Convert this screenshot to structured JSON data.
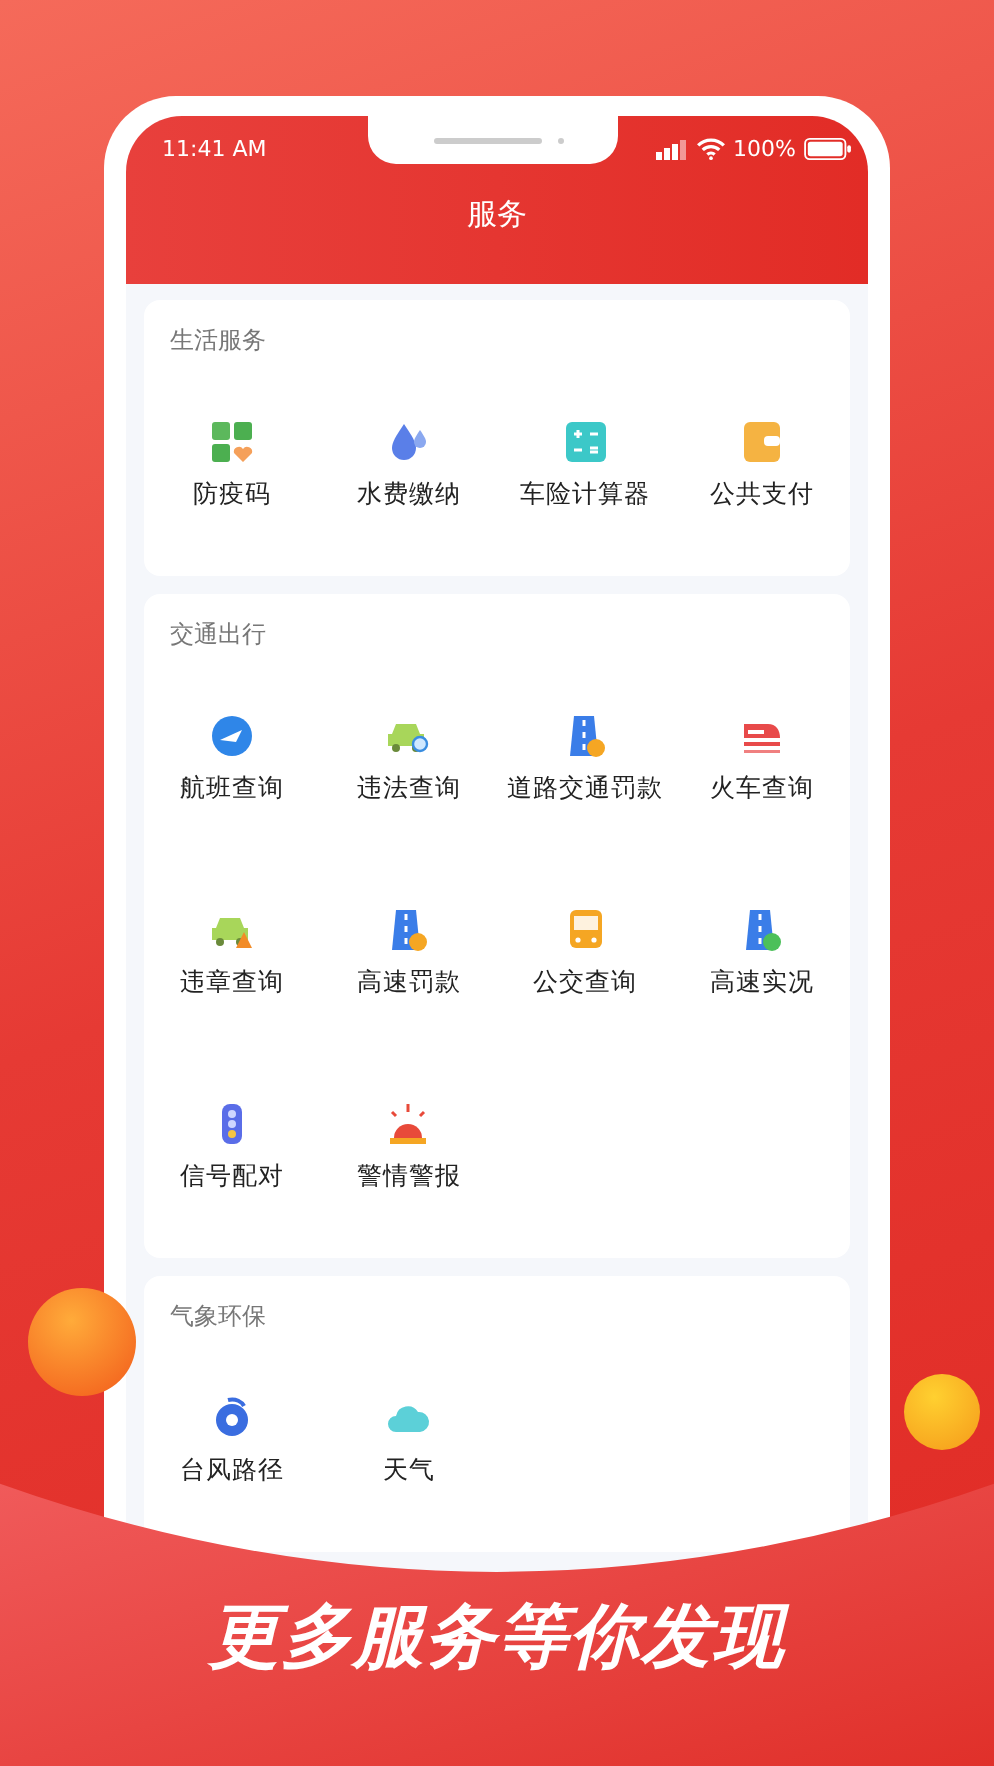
{
  "status_bar": {
    "time": "11:41 AM",
    "battery": "100%"
  },
  "header": {
    "title": "服务"
  },
  "sections": [
    {
      "title": "生活服务",
      "items": [
        {
          "label": "防疫码",
          "kind": "health-code"
        },
        {
          "label": "水费缴纳",
          "kind": "water"
        },
        {
          "label": "车险计算器",
          "kind": "calculator"
        },
        {
          "label": "公共支付",
          "kind": "wallet"
        }
      ]
    },
    {
      "title": "交通出行",
      "items": [
        {
          "label": "航班查询",
          "kind": "flight"
        },
        {
          "label": "违法查询",
          "kind": "car-search"
        },
        {
          "label": "道路交通罚款",
          "kind": "road-fine"
        },
        {
          "label": "火车查询",
          "kind": "train"
        },
        {
          "label": "违章查询",
          "kind": "car-cone"
        },
        {
          "label": "高速罚款",
          "kind": "road-fine"
        },
        {
          "label": "公交查询",
          "kind": "bus"
        },
        {
          "label": "高速实况",
          "kind": "road-live"
        },
        {
          "label": "信号配对",
          "kind": "traffic-light"
        },
        {
          "label": "警情警报",
          "kind": "siren"
        }
      ]
    },
    {
      "title": "气象环保",
      "items": [
        {
          "label": "台风路径",
          "kind": "typhoon"
        },
        {
          "label": "天气",
          "kind": "cloud"
        }
      ]
    }
  ],
  "banner": {
    "slogan": "更多服务等你发现"
  }
}
